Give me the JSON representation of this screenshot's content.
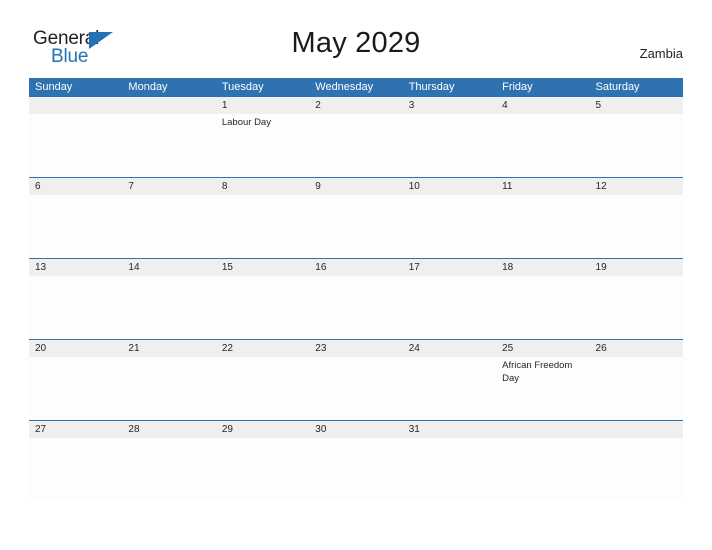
{
  "brand": {
    "name_part1": "General",
    "name_part2": "Blue",
    "accent_color": "#2372b9"
  },
  "header": {
    "title": "May 2029",
    "country": "Zambia"
  },
  "calendar": {
    "header_color": "#2e72b0",
    "band_color": "#efefef",
    "weekdays": [
      "Sunday",
      "Monday",
      "Tuesday",
      "Wednesday",
      "Thursday",
      "Friday",
      "Saturday"
    ],
    "weeks": [
      {
        "days": [
          {
            "num": "",
            "event": ""
          },
          {
            "num": "",
            "event": ""
          },
          {
            "num": "1",
            "event": "Labour Day"
          },
          {
            "num": "2",
            "event": ""
          },
          {
            "num": "3",
            "event": ""
          },
          {
            "num": "4",
            "event": ""
          },
          {
            "num": "5",
            "event": ""
          }
        ]
      },
      {
        "days": [
          {
            "num": "6",
            "event": ""
          },
          {
            "num": "7",
            "event": ""
          },
          {
            "num": "8",
            "event": ""
          },
          {
            "num": "9",
            "event": ""
          },
          {
            "num": "10",
            "event": ""
          },
          {
            "num": "11",
            "event": ""
          },
          {
            "num": "12",
            "event": ""
          }
        ]
      },
      {
        "days": [
          {
            "num": "13",
            "event": ""
          },
          {
            "num": "14",
            "event": ""
          },
          {
            "num": "15",
            "event": ""
          },
          {
            "num": "16",
            "event": ""
          },
          {
            "num": "17",
            "event": ""
          },
          {
            "num": "18",
            "event": ""
          },
          {
            "num": "19",
            "event": ""
          }
        ]
      },
      {
        "days": [
          {
            "num": "20",
            "event": ""
          },
          {
            "num": "21",
            "event": ""
          },
          {
            "num": "22",
            "event": ""
          },
          {
            "num": "23",
            "event": ""
          },
          {
            "num": "24",
            "event": ""
          },
          {
            "num": "25",
            "event": "African Freedom Day"
          },
          {
            "num": "26",
            "event": ""
          }
        ]
      },
      {
        "days": [
          {
            "num": "27",
            "event": ""
          },
          {
            "num": "28",
            "event": ""
          },
          {
            "num": "29",
            "event": ""
          },
          {
            "num": "30",
            "event": ""
          },
          {
            "num": "31",
            "event": ""
          },
          {
            "num": "",
            "event": ""
          },
          {
            "num": "",
            "event": ""
          }
        ]
      }
    ]
  }
}
